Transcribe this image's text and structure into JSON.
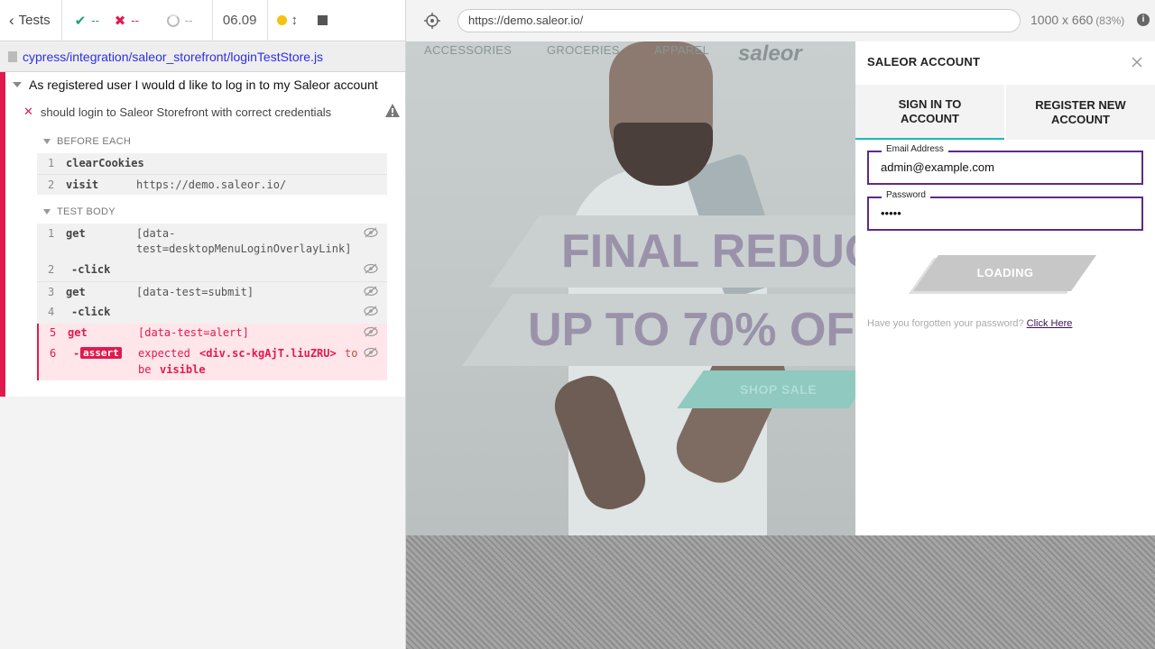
{
  "reporter": {
    "tests_label": "Tests",
    "passed": "--",
    "failed": "--",
    "pending": "--",
    "duration": "06.09",
    "spec_path": "cypress/integration/saleor_storefront/loginTestStore.js",
    "suite_title": "As registered user I would d like to log in to my Saleor account",
    "test_title": "should login to Saleor Storefront with correct credentials",
    "before_each_label": "BEFORE EACH",
    "test_body_label": "TEST BODY",
    "before_each": [
      {
        "num": "1",
        "name": "clearCookies",
        "msg": ""
      },
      {
        "num": "2",
        "name": "visit",
        "msg": "https://demo.saleor.io/"
      }
    ],
    "body": [
      {
        "num": "1",
        "name": "get",
        "msg_line1": "[data-",
        "msg_line2": "test=desktopMenuLoginOverlayLink]"
      },
      {
        "num": "2",
        "name": "-click",
        "msg": ""
      },
      {
        "num": "3",
        "name": "get",
        "msg": "[data-test=submit]"
      },
      {
        "num": "4",
        "name": "-click",
        "msg": ""
      },
      {
        "num": "5",
        "name": "get",
        "msg": "[data-test=alert]"
      },
      {
        "num": "6",
        "prefix": "-",
        "badge": "assert",
        "msg_a": "expected",
        "msg_b": "<div.sc-kgAjT.liuZRU>",
        "msg_c": "to",
        "msg_d": "be",
        "msg_e": "visible"
      }
    ]
  },
  "aut": {
    "url": "https://demo.saleor.io/",
    "viewport": "1000 x 660",
    "scale": "(83%)",
    "nav": [
      "ACCESSORIES",
      "GROCERIES",
      "APPAREL"
    ],
    "logo": "saleor",
    "banner1": "FINAL REDUC",
    "banner2": "UP TO 70% OF",
    "shop_sale": "SHOP SALE",
    "panel": {
      "title": "SALEOR ACCOUNT",
      "tab_signin_1": "SIGN IN TO",
      "tab_signin_2": "ACCOUNT",
      "tab_register_1": "REGISTER NEW",
      "tab_register_2": "ACCOUNT",
      "email_label": "Email Address",
      "email_value": "admin@example.com",
      "password_label": "Password",
      "password_value": "•••••",
      "button_label": "LOADING",
      "forgot_text": "Have you forgotten your password?",
      "forgot_link": "Click Here"
    }
  },
  "colors": {
    "fail": "#e01a4f",
    "pass": "#1aa07a",
    "accent_teal": "#13bebb",
    "field_border": "#5e2a8a"
  }
}
